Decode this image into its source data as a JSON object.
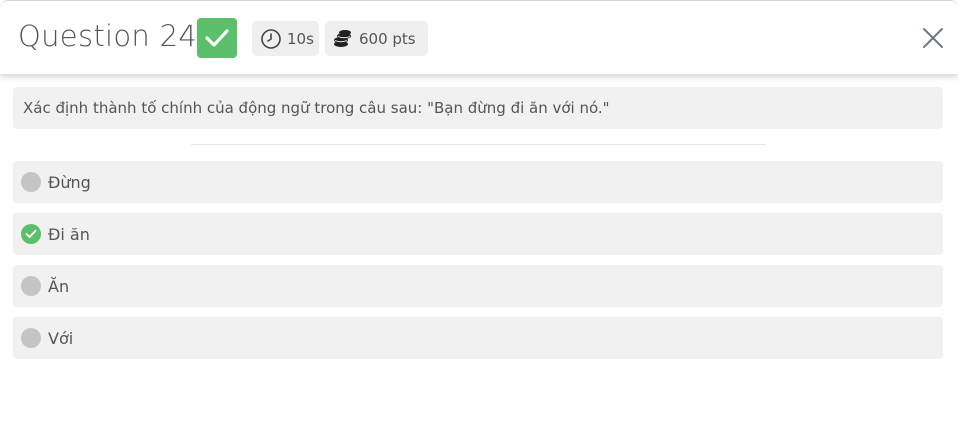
{
  "header": {
    "title": "Question 24",
    "time": "10s",
    "points": "600 pts",
    "status_icon": "checkmark-icon",
    "time_icon": "clock-icon",
    "points_icon": "coins-icon",
    "close_icon": "close-icon"
  },
  "colors": {
    "correct": "#5cbf6c",
    "neutral_radio": "#c4c4c4",
    "panel_bg": "#f1f1f1"
  },
  "question": {
    "text": "Xác định thành tố chính của động ngữ trong câu sau: \"Bạn đừng đi ăn với nó.\""
  },
  "options": [
    {
      "label": "Đừng",
      "correct": false
    },
    {
      "label": "Đi ăn",
      "correct": true
    },
    {
      "label": "Ăn",
      "correct": false
    },
    {
      "label": "Với",
      "correct": false
    }
  ]
}
